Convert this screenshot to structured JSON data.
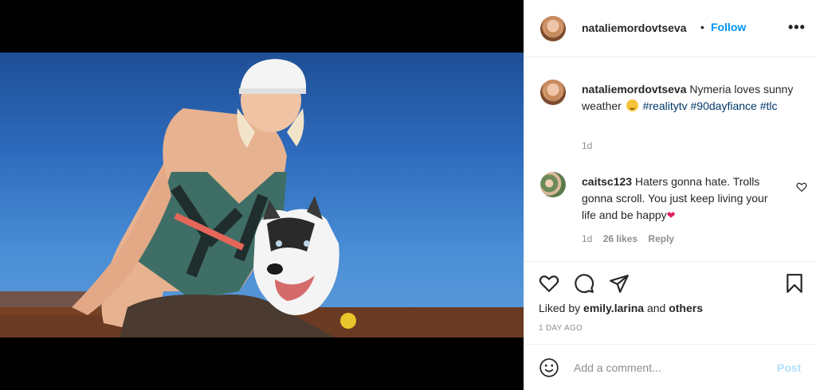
{
  "post": {
    "username": "nataliemordovtseva",
    "separator": "•",
    "follow_label": "Follow",
    "more_icon": "more-options-icon",
    "more_label": "•••"
  },
  "caption": {
    "username": "nataliemordovtseva",
    "text": "Nymeria loves sunny weather",
    "emoji": "smiling-face-emoji",
    "hashtags": [
      "#realitytv",
      "#90dayfiance",
      "#tlc"
    ],
    "time": "1d"
  },
  "comment": {
    "username": "caitsc123",
    "text_line1": "Haters gonna hate.",
    "text_line2": "Trolls gonna scroll. You just keep living your life and be happy",
    "emoji": "red-heart-emoji",
    "heart_glyph": "❤",
    "time": "1d",
    "likes": "26 likes",
    "reply_label": "Reply"
  },
  "actions": {
    "liked_by_prefix": "Liked by",
    "liked_by_user": "emily.larina",
    "liked_by_and": "and",
    "liked_by_others": "others",
    "posted_ago": "1 DAY AGO"
  },
  "add_comment": {
    "placeholder": "Add a comment...",
    "post_label": "Post"
  },
  "colors": {
    "follow_blue": "#0095f6",
    "hashtag_blue": "#00376b",
    "post_disabled": "#b2dffc",
    "muted_text": "#8e8e8e"
  }
}
